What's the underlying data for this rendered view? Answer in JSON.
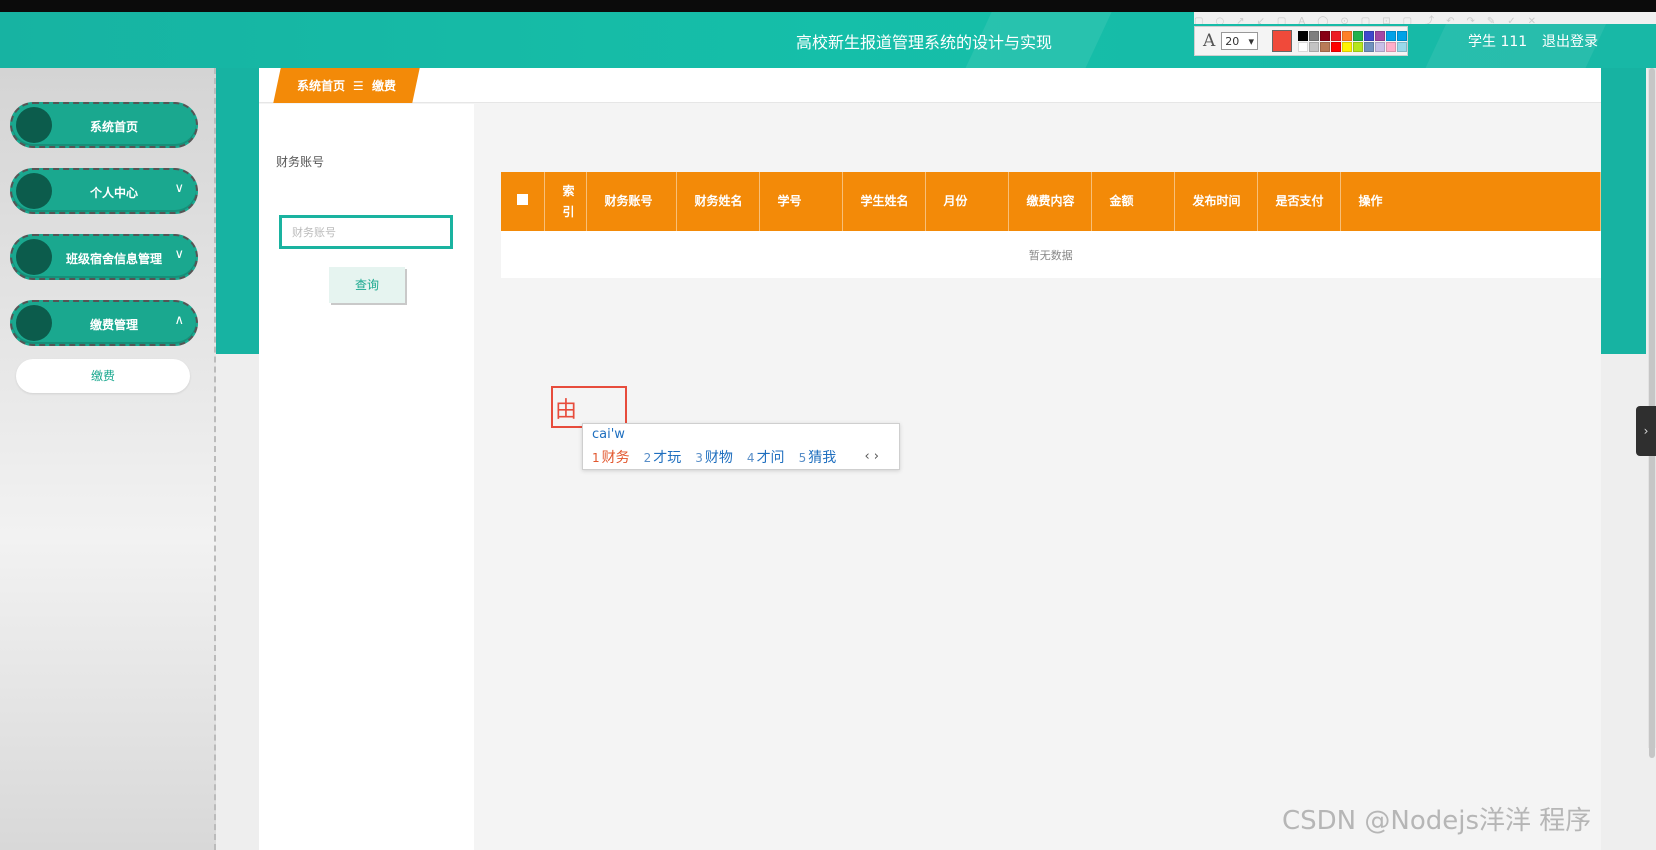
{
  "header": {
    "title": "高校新生报道管理系统的设计与实现",
    "user": "学生 111",
    "logout": "退出登录",
    "background_color": "#17b3a2"
  },
  "annotation_toolbar": {
    "font_icon": "A",
    "font_size": "20",
    "current_color": "#f04a3a",
    "swatches": [
      "#000000",
      "#7f7f7f",
      "#880015",
      "#ed1c24",
      "#ff7f27",
      "#22b14c",
      "#3f48cc",
      "#a349a4",
      "#00a2e8",
      "#00a2e8",
      "#ffffff",
      "#c3c3c3",
      "#b97a57",
      "#ff0000",
      "#fff200",
      "#b5e61d",
      "#7092be",
      "#c8bfe7",
      "#ffaec9",
      "#99d9ea"
    ]
  },
  "sidebar": {
    "items": [
      {
        "label": "系统首页",
        "chevron": ""
      },
      {
        "label": "个人中心",
        "chevron": "∨"
      },
      {
        "label": "班级宿舍信息管理",
        "chevron": "∨"
      },
      {
        "label": "缴费管理",
        "chevron": "∧"
      }
    ],
    "subitem": "缴费"
  },
  "breadcrumb": {
    "home": "系统首页",
    "separator": "☰",
    "current": "缴费"
  },
  "search": {
    "label": "财务账号",
    "placeholder": "财务账号",
    "button": "查询"
  },
  "table": {
    "headers": [
      "索引",
      "财务账号",
      "财务姓名",
      "学号",
      "学生姓名",
      "月份",
      "缴费内容",
      "金额",
      "发布时间",
      "是否支付",
      "操作"
    ],
    "empty_text": "暂无数据",
    "header_color": "#f38a08"
  },
  "ime": {
    "typed_char": "由",
    "pinyin": "cai'w",
    "candidates": [
      {
        "n": "1",
        "text": "财务"
      },
      {
        "n": "2",
        "text": "才玩"
      },
      {
        "n": "3",
        "text": "财物"
      },
      {
        "n": "4",
        "text": "才问"
      },
      {
        "n": "5",
        "text": "猜我"
      }
    ],
    "nav": "‹ ›"
  },
  "watermark": "CSDN @Nodejs洋洋  程序"
}
